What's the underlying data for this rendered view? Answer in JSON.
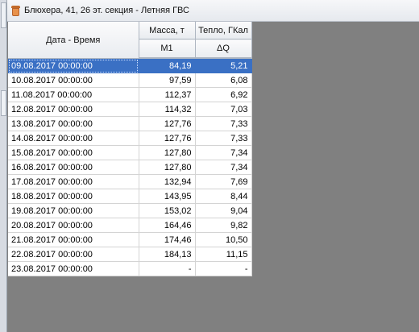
{
  "window": {
    "title": "Блюхера, 41, 26 эт. секция - Летняя ГВС",
    "icon": "cup-icon"
  },
  "table": {
    "headers": {
      "datetime": "Дата - Время",
      "mass": "Масса, т",
      "heat": "Тепло, ГКал",
      "mass_sub": "M1",
      "heat_sub": "ΔQ"
    },
    "rows": [
      {
        "datetime": "09.08.2017 00:00:00",
        "mass": "84,19",
        "heat": "5,21"
      },
      {
        "datetime": "10.08.2017 00:00:00",
        "mass": "97,59",
        "heat": "6,08"
      },
      {
        "datetime": "11.08.2017 00:00:00",
        "mass": "112,37",
        "heat": "6,92"
      },
      {
        "datetime": "12.08.2017 00:00:00",
        "mass": "114,32",
        "heat": "7,03"
      },
      {
        "datetime": "13.08.2017 00:00:00",
        "mass": "127,76",
        "heat": "7,33"
      },
      {
        "datetime": "14.08.2017 00:00:00",
        "mass": "127,76",
        "heat": "7,33"
      },
      {
        "datetime": "15.08.2017 00:00:00",
        "mass": "127,80",
        "heat": "7,34"
      },
      {
        "datetime": "16.08.2017 00:00:00",
        "mass": "127,80",
        "heat": "7,34"
      },
      {
        "datetime": "17.08.2017 00:00:00",
        "mass": "132,94",
        "heat": "7,69"
      },
      {
        "datetime": "18.08.2017 00:00:00",
        "mass": "143,95",
        "heat": "8,44"
      },
      {
        "datetime": "19.08.2017 00:00:00",
        "mass": "153,02",
        "heat": "9,04"
      },
      {
        "datetime": "20.08.2017 00:00:00",
        "mass": "164,46",
        "heat": "9,82"
      },
      {
        "datetime": "21.08.2017 00:00:00",
        "mass": "174,46",
        "heat": "10,50"
      },
      {
        "datetime": "22.08.2017 00:00:00",
        "mass": "184,13",
        "heat": "11,15"
      },
      {
        "datetime": "23.08.2017 00:00:00",
        "mass": "-",
        "heat": "-"
      }
    ],
    "selected_row": 0
  },
  "colors": {
    "selection": "#3a70c4",
    "workspace": "#808080"
  }
}
